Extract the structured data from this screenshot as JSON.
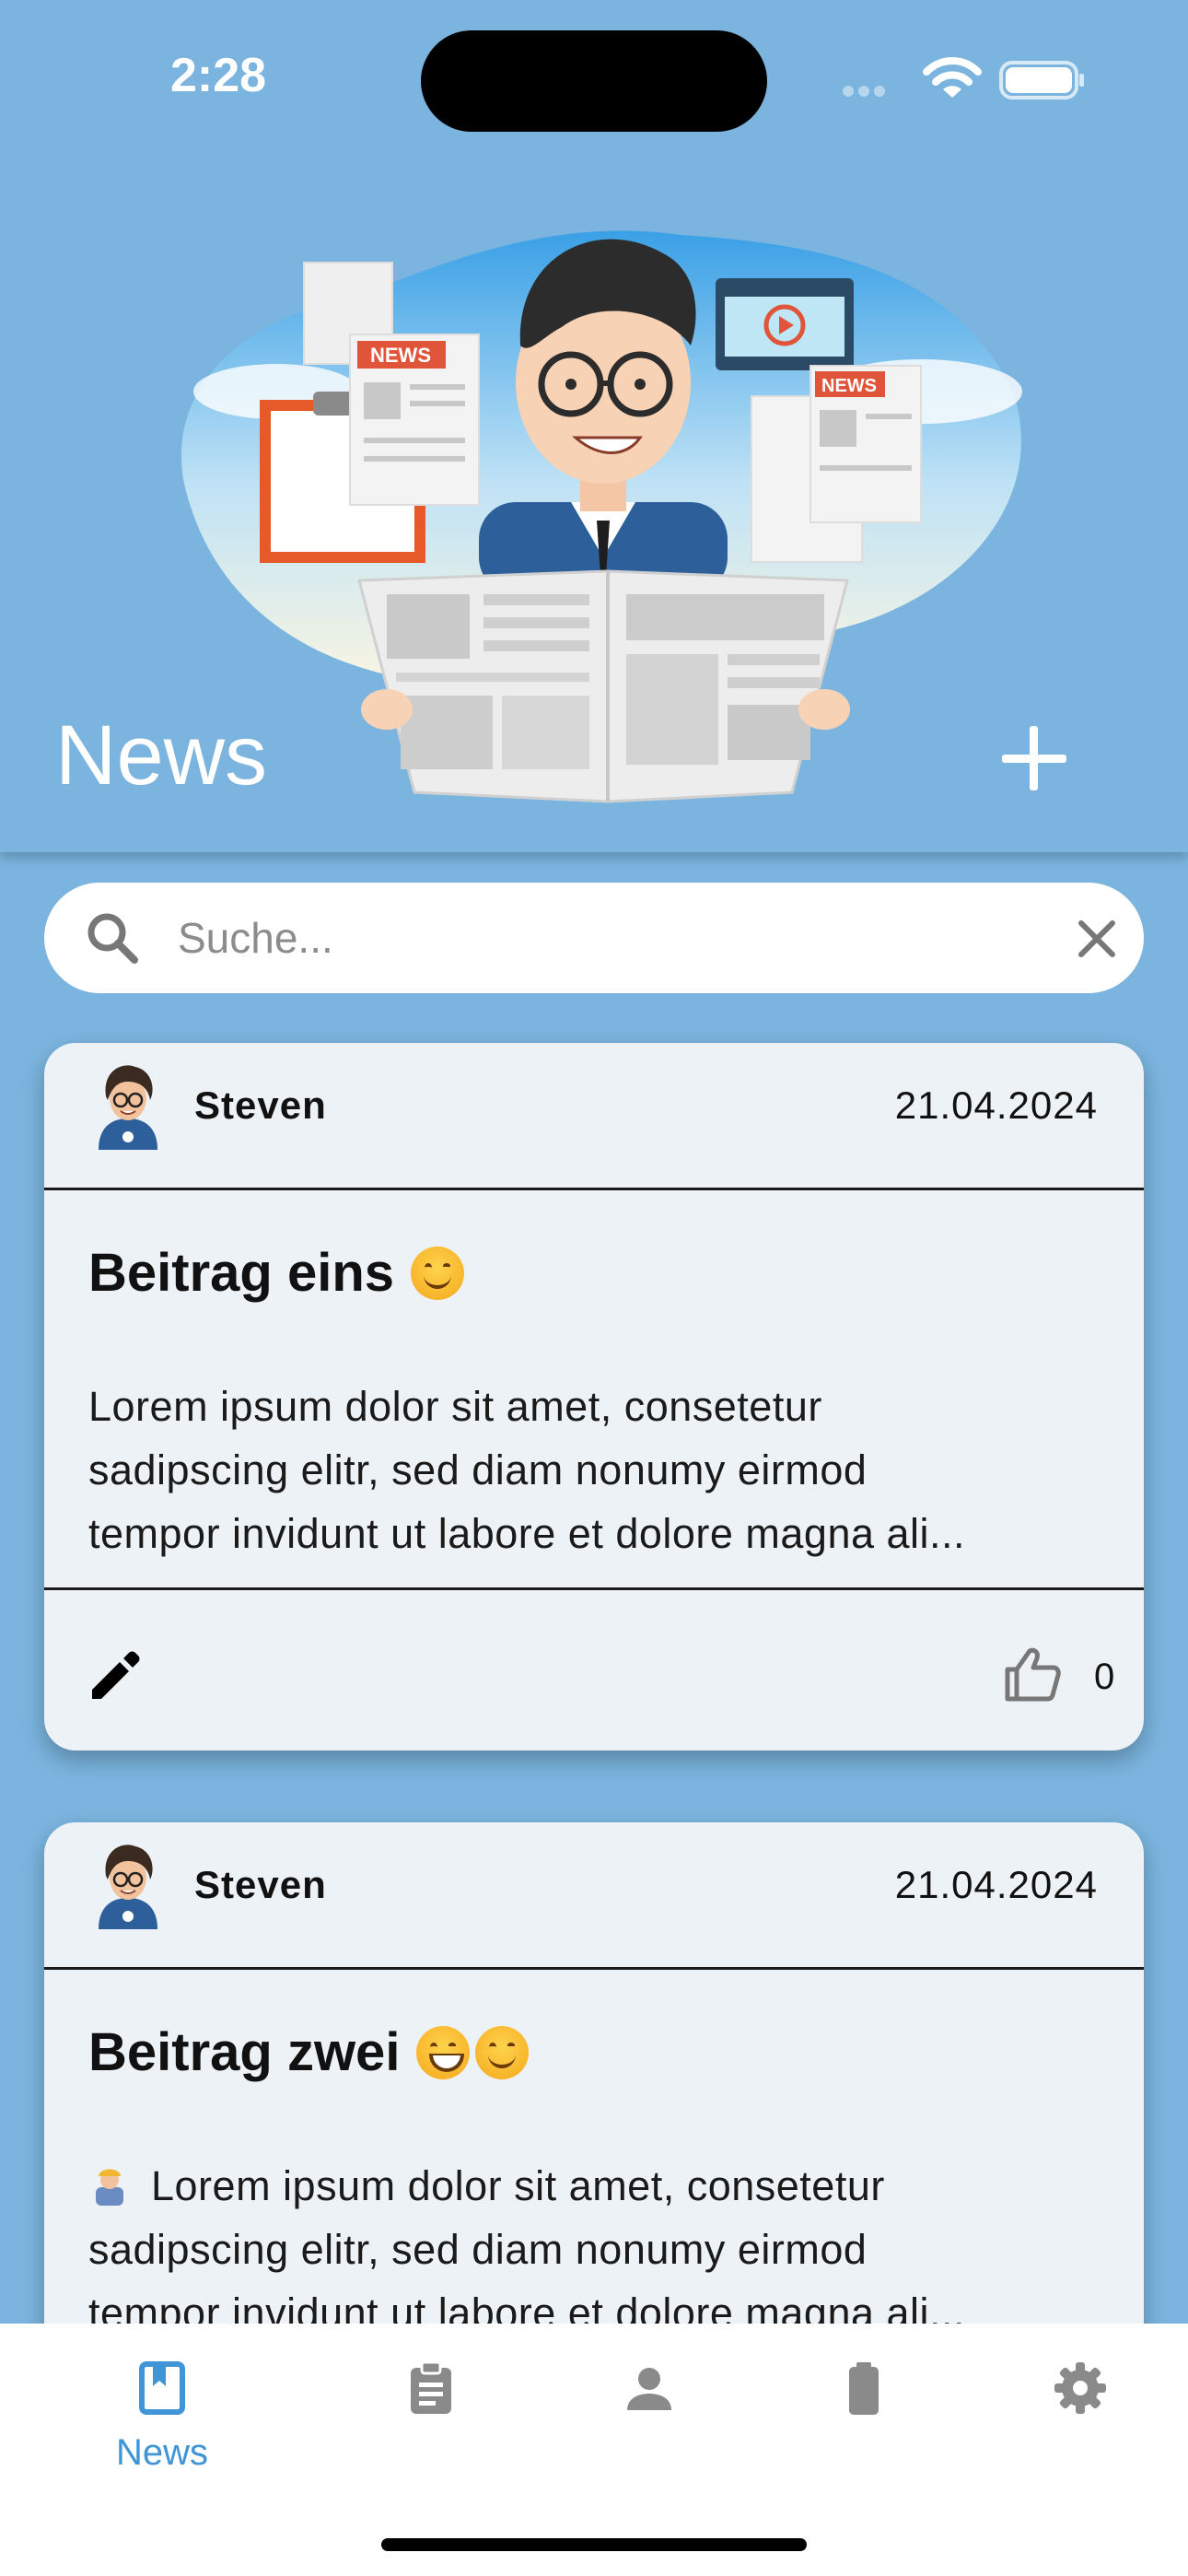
{
  "status_bar": {
    "time": "2:28"
  },
  "header": {
    "title": "News"
  },
  "search": {
    "placeholder": "Suche..."
  },
  "posts": [
    {
      "author": "Steven",
      "date": "21.04.2024",
      "title": "Beitrag eins",
      "title_emojis": [
        "smiling-face-icon"
      ],
      "lines": [
        "Lorem ipsum dolor sit amet, consetetur",
        "sadipscing elitr, sed diam nonumy eirmod",
        "tempor invidunt ut labore et dolore magna ali..."
      ],
      "likes": "0"
    },
    {
      "author": "Steven",
      "date": "21.04.2024",
      "title": "Beitrag zwei",
      "title_emojis": [
        "grinning-face-icon",
        "smiling-face-icon"
      ],
      "lines": [
        "Lorem ipsum dolor sit amet, consetetur",
        "sadipscing elitr, sed diam nonumy eirmod",
        "tempor invidunt ut labore et dolore magna ali..."
      ]
    }
  ],
  "nav": {
    "items": [
      {
        "label": "News",
        "icon": "bookmark-book-icon",
        "active": true
      },
      {
        "label": "",
        "icon": "clipboard-icon"
      },
      {
        "label": "",
        "icon": "person-icon"
      },
      {
        "label": "",
        "icon": "battery-icon"
      },
      {
        "label": "",
        "icon": "gear-icon"
      }
    ]
  },
  "colors": {
    "background": "#7bb5df",
    "card": "#edf2f7",
    "accent": "#3f95d6",
    "nav_inactive": "#8a8a8a"
  }
}
